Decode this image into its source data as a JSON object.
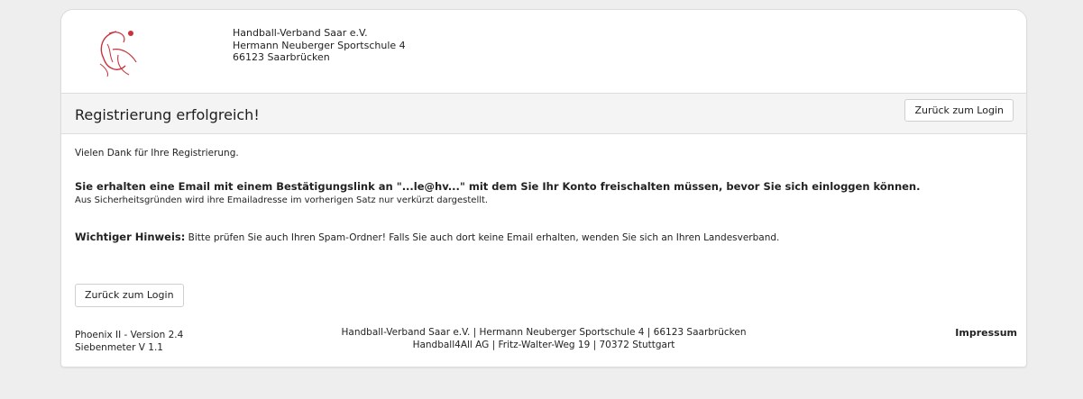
{
  "header": {
    "logo_name": "handball-verband-logo",
    "address_lines": [
      "Handball-Verband Saar e.V.",
      "Hermann Neuberger Sportschule 4",
      "66123 Saarbrücken"
    ]
  },
  "title_bar": {
    "title": "Registrierung erfolgreich!",
    "back_button": "Zurück zum Login"
  },
  "content": {
    "thanks": "Vielen Dank für Ihre Registrierung.",
    "email_notice": "Sie erhalten eine Email mit einem Bestätigungslink an \"...le@hv...\" mit dem Sie Ihr Konto freischalten müssen, bevor Sie sich einloggen können.",
    "security_notice": "Aus Sicherheitsgründen wird ihre Emailadresse im vorherigen Satz nur verkürzt dargestellt.",
    "hint_label": "Wichtiger Hinweis:",
    "hint_text": " Bitte prüfen Sie auch Ihren Spam-Ordner! Falls Sie auch dort keine Email erhalten, wenden Sie sich an Ihren Landesverband.",
    "back_button": "Zurück zum Login"
  },
  "footer": {
    "version": "Phoenix II - Version 2.4",
    "sub_version": "Siebenmeter V 1.1",
    "line1": "Handball-Verband Saar e.V. | Hermann Neuberger Sportschule 4 | 66123 Saarbrücken",
    "line2": "Handball4All AG | Fritz-Walter-Weg 19 | 70372 Stuttgart",
    "impressum": "Impressum"
  },
  "colors": {
    "logo_red": "#c9333b",
    "page_bg": "#eeeeef",
    "title_bar_bg": "#f4f4f5"
  }
}
